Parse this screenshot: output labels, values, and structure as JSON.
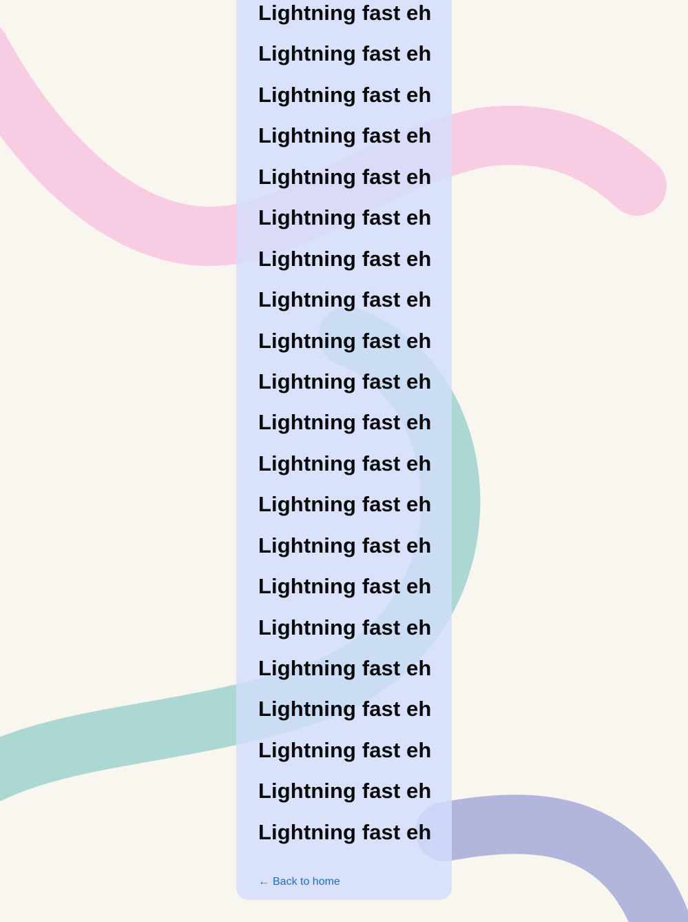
{
  "content": {
    "repeated_lines": [
      "Lightning fast eh",
      "Lightning fast eh",
      "Lightning fast eh",
      "Lightning fast eh",
      "Lightning fast eh",
      "Lightning fast eh",
      "Lightning fast eh",
      "Lightning fast eh",
      "Lightning fast eh",
      "Lightning fast eh",
      "Lightning fast eh",
      "Lightning fast eh",
      "Lightning fast eh",
      "Lightning fast eh",
      "Lightning fast eh",
      "Lightning fast eh",
      "Lightning fast eh",
      "Lightning fast eh",
      "Lightning fast eh",
      "Lightning fast eh",
      "Lightning fast eh"
    ]
  },
  "footer": {
    "back_arrow": "←",
    "back_label": "Back to home"
  },
  "colors": {
    "page_background": "#f9f5ef",
    "card_background": "#dce3fa",
    "pink_swoosh": "#f8cde3",
    "teal_swoosh": "#abd8d2",
    "purple_swoosh": "#b3b6dc",
    "link": "#1a6ad3",
    "text": "#0a0a0a"
  },
  "decorations": {
    "swooshes": [
      "pink-swoosh",
      "teal-swoosh",
      "purple-swoosh"
    ]
  }
}
